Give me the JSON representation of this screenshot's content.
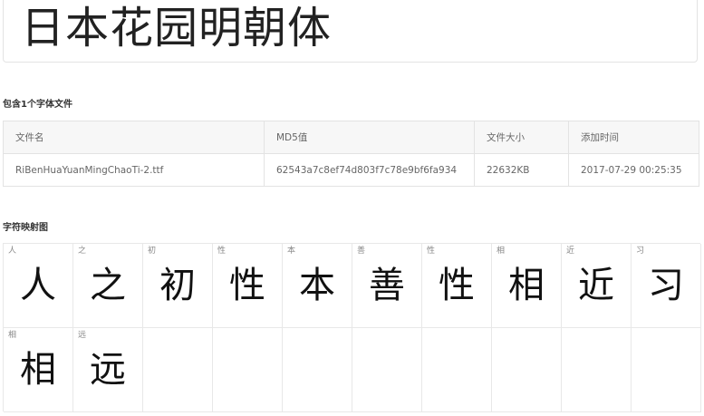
{
  "preview": {
    "text": "日本花园明朝体"
  },
  "files_section": {
    "title": "包含1个字体文件",
    "columns": [
      "文件名",
      "MD5值",
      "文件大小",
      "添加时间"
    ],
    "rows": [
      [
        "RiBenHuaYuanMingChaoTi-2.ttf",
        "62543a7c8ef74d803f7c78e9bf6fa934",
        "22632KB",
        "2017-07-29 00:25:35"
      ]
    ]
  },
  "map_section": {
    "title": "字符映射图",
    "glyphs": [
      {
        "label": "人",
        "char": "人"
      },
      {
        "label": "之",
        "char": "之"
      },
      {
        "label": "初",
        "char": "初"
      },
      {
        "label": "性",
        "char": "性"
      },
      {
        "label": "本",
        "char": "本"
      },
      {
        "label": "善",
        "char": "善"
      },
      {
        "label": "性",
        "char": "性"
      },
      {
        "label": "相",
        "char": "相"
      },
      {
        "label": "近",
        "char": "近"
      },
      {
        "label": "习",
        "char": "习"
      },
      {
        "label": "相",
        "char": "相"
      },
      {
        "label": "远",
        "char": "远"
      }
    ]
  }
}
